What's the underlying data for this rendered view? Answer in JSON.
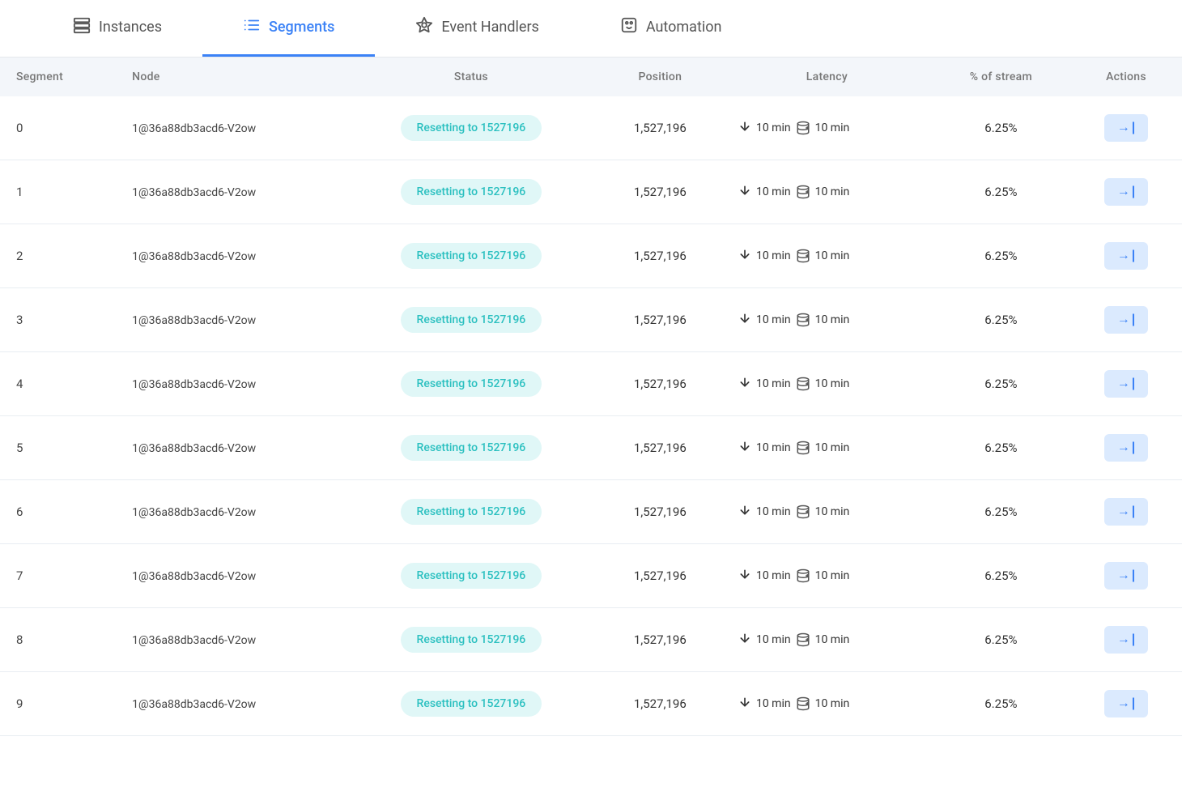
{
  "nav": {
    "items": [
      {
        "id": "instances",
        "label": "Instances",
        "active": false,
        "icon": "instances"
      },
      {
        "id": "segments",
        "label": "Segments",
        "active": true,
        "icon": "segments"
      },
      {
        "id": "event-handlers",
        "label": "Event Handlers",
        "active": false,
        "icon": "event-handlers"
      },
      {
        "id": "automation",
        "label": "Automation",
        "active": false,
        "icon": "automation"
      }
    ]
  },
  "table": {
    "headers": [
      {
        "id": "segment",
        "label": "Segment"
      },
      {
        "id": "node",
        "label": "Node"
      },
      {
        "id": "status",
        "label": "Status"
      },
      {
        "id": "position",
        "label": "Position"
      },
      {
        "id": "latency",
        "label": "Latency"
      },
      {
        "id": "percent-stream",
        "label": "% of stream"
      },
      {
        "id": "actions",
        "label": "Actions"
      }
    ],
    "rows": [
      {
        "segment": "0",
        "node": "1@36a88db3acd6-V2ow",
        "status": "Resetting to 1527196",
        "position": "1,527,196",
        "latency_down": "10 min",
        "latency_db": "10 min",
        "percent": "6.25%"
      },
      {
        "segment": "1",
        "node": "1@36a88db3acd6-V2ow",
        "status": "Resetting to 1527196",
        "position": "1,527,196",
        "latency_down": "10 min",
        "latency_db": "10 min",
        "percent": "6.25%"
      },
      {
        "segment": "2",
        "node": "1@36a88db3acd6-V2ow",
        "status": "Resetting to 1527196",
        "position": "1,527,196",
        "latency_down": "10 min",
        "latency_db": "10 min",
        "percent": "6.25%"
      },
      {
        "segment": "3",
        "node": "1@36a88db3acd6-V2ow",
        "status": "Resetting to 1527196",
        "position": "1,527,196",
        "latency_down": "10 min",
        "latency_db": "10 min",
        "percent": "6.25%"
      },
      {
        "segment": "4",
        "node": "1@36a88db3acd6-V2ow",
        "status": "Resetting to 1527196",
        "position": "1,527,196",
        "latency_down": "10 min",
        "latency_db": "10 min",
        "percent": "6.25%"
      },
      {
        "segment": "5",
        "node": "1@36a88db3acd6-V2ow",
        "status": "Resetting to 1527196",
        "position": "1,527,196",
        "latency_down": "10 min",
        "latency_db": "10 min",
        "percent": "6.25%"
      },
      {
        "segment": "6",
        "node": "1@36a88db3acd6-V2ow",
        "status": "Resetting to 1527196",
        "position": "1,527,196",
        "latency_down": "10 min",
        "latency_db": "10 min",
        "percent": "6.25%"
      },
      {
        "segment": "7",
        "node": "1@36a88db3acd6-V2ow",
        "status": "Resetting to 1527196",
        "position": "1,527,196",
        "latency_down": "10 min",
        "latency_db": "10 min",
        "percent": "6.25%"
      },
      {
        "segment": "8",
        "node": "1@36a88db3acd6-V2ow",
        "status": "Resetting to 1527196",
        "position": "1,527,196",
        "latency_down": "10 min",
        "latency_db": "10 min",
        "percent": "6.25%"
      },
      {
        "segment": "9",
        "node": "1@36a88db3acd6-V2ow",
        "status": "Resetting to 1527196",
        "position": "1,527,196",
        "latency_down": "10 min",
        "latency_db": "10 min",
        "percent": "6.25%"
      }
    ],
    "action_label": "→|"
  }
}
